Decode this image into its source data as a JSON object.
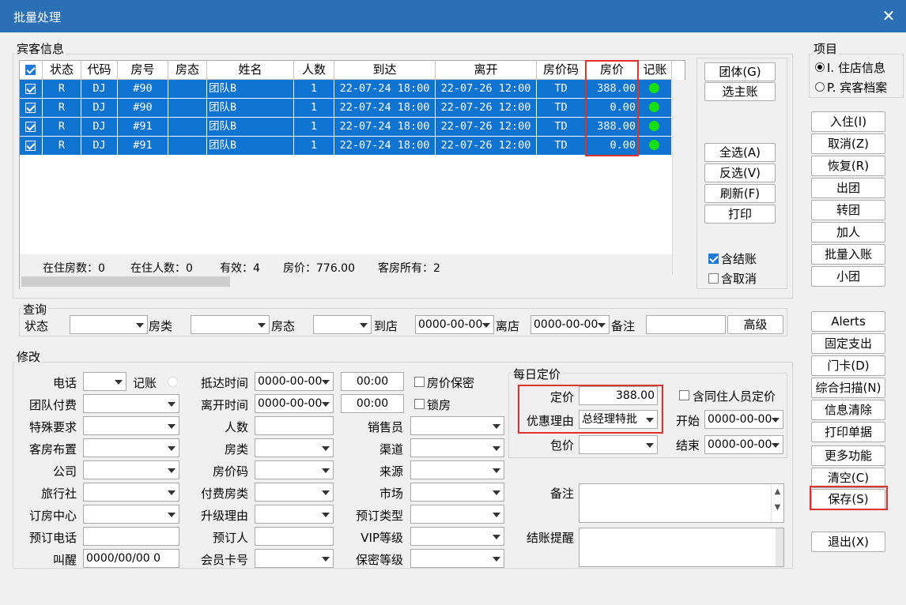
{
  "window": {
    "title": "批量处理",
    "close": "✕"
  },
  "guest": {
    "group_label": "宾客信息",
    "headers": [
      "状态",
      "代码",
      "房号",
      "房态",
      "姓名",
      "人数",
      "到达",
      "离开",
      "房价码",
      "房价",
      "记账"
    ],
    "rows": [
      {
        "status": "R",
        "code": "DJ",
        "room": "#90",
        "roomstate": "",
        "name": "团队B",
        "people": "1",
        "arrive": "22-07-24 18:00",
        "depart": "22-07-26 12:00",
        "ratecode": "TD",
        "price": "388.00"
      },
      {
        "status": "R",
        "code": "DJ",
        "room": "#90",
        "roomstate": "",
        "name": "团队B",
        "people": "1",
        "arrive": "22-07-24 18:00",
        "depart": "22-07-26 12:00",
        "ratecode": "TD",
        "price": "0.00"
      },
      {
        "status": "R",
        "code": "DJ",
        "room": "#91",
        "roomstate": "",
        "name": "团队B",
        "people": "1",
        "arrive": "22-07-24 18:00",
        "depart": "22-07-26 12:00",
        "ratecode": "TD",
        "price": "388.00"
      },
      {
        "status": "R",
        "code": "DJ",
        "room": "#91",
        "roomstate": "",
        "name": "团队B",
        "people": "1",
        "arrive": "22-07-24 18:00",
        "depart": "22-07-26 12:00",
        "ratecode": "TD",
        "price": "0.00"
      }
    ],
    "summary": [
      "在住房数：0",
      "在住人数：0",
      "有效：4",
      "房价：776.00",
      "客房所有：2"
    ]
  },
  "side_buttons": {
    "group": "团体(G)",
    "main_acct": "选主账",
    "select_all": "全选(A)",
    "invert": "反选(V)",
    "refresh": "刷新(F)",
    "print": "打印",
    "incl_settled": "含结账",
    "incl_cancel": "含取消"
  },
  "project": {
    "label": "项目",
    "opt1": "I. 住店信息",
    "opt2": "P. 宾客档案"
  },
  "actions": [
    "入住(I)",
    "取消(Z)",
    "恢复(R)",
    "出团",
    "转团",
    "加人",
    "批量入账",
    "小团",
    "Alerts",
    "固定支出",
    "门卡(D)",
    "综合扫描(N)",
    "信息清除",
    "打印单据",
    "更多功能",
    "清空(C)",
    "保存(S)",
    "退出(X)"
  ],
  "query": {
    "label": "查询",
    "status": "状态",
    "roomtype": "房类",
    "roomstate": "房态",
    "arrive": "到店",
    "arrive_val": "0000-00-00",
    "depart": "离店",
    "depart_val": "0000-00-00",
    "remark": "备注",
    "advanced": "高级"
  },
  "modify": {
    "label": "修改",
    "col1": [
      "电话",
      "团队付费",
      "特殊要求",
      "客房布置",
      "公司",
      "旅行社",
      "订房中心",
      "预订电话",
      "叫醒"
    ],
    "wake_val": "0000/00/00 0",
    "acct": "记账",
    "col2": [
      "抵达时间",
      "离开时间",
      "人数",
      "房类",
      "房价码",
      "付费房类",
      "升级理由",
      "预订人",
      "会员卡号"
    ],
    "arrive_date": "0000-00-00",
    "arrive_time": "00:00",
    "depart_date": "0000-00-00",
    "depart_time": "00:00",
    "price_secret": "房价保密",
    "lock_room": "锁房",
    "col3": [
      "销售员",
      "渠道",
      "来源",
      "市场",
      "预订类型",
      "VIP等级",
      "保密等级"
    ],
    "daily": {
      "label": "每日定价",
      "fixed": "定价",
      "fixed_val": "388.00",
      "reason": "优惠理由",
      "reason_val": "总经理特批",
      "package": "包价",
      "incl_cohab": "含同住人员定价",
      "start": "开始",
      "start_val": "0000-00-00",
      "end": "结束",
      "end_val": "0000-00-00"
    },
    "remark": "备注",
    "checkout_tip": "结账提醒"
  }
}
